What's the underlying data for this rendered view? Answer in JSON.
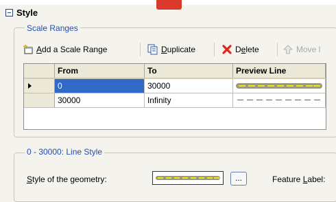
{
  "header": {
    "title": "Style"
  },
  "scale_ranges": {
    "legend": "Scale Ranges",
    "toolbar": {
      "add_prefix": "A",
      "add_rest": "dd a Scale Range",
      "duplicate_prefix": "D",
      "duplicate_rest": "uplicate",
      "delete_prefix": "D",
      "delete_u": "e",
      "delete_rest": "lete",
      "move_label": "Move l"
    },
    "columns": {
      "from": "From",
      "to": "To",
      "preview": "Preview Line"
    },
    "rows": [
      {
        "from": "0",
        "to": "30000"
      },
      {
        "from": "30000",
        "to": "Infinity"
      }
    ]
  },
  "line_style": {
    "legend": "0 - 30000: Line Style",
    "geometry_label_prefix": "S",
    "geometry_label_rest": "tyle of the geometry:",
    "ellipsis": "...",
    "feature_label_prefix": "Feature ",
    "feature_label_u": "L",
    "feature_label_rest": "abel:"
  },
  "colors": {
    "selection": "#3169c6",
    "legend_text": "#1f4fb4",
    "accent_red": "#d93a2b",
    "preview_green": "#0c9a2a",
    "preview_yellow": "#f5e600"
  }
}
